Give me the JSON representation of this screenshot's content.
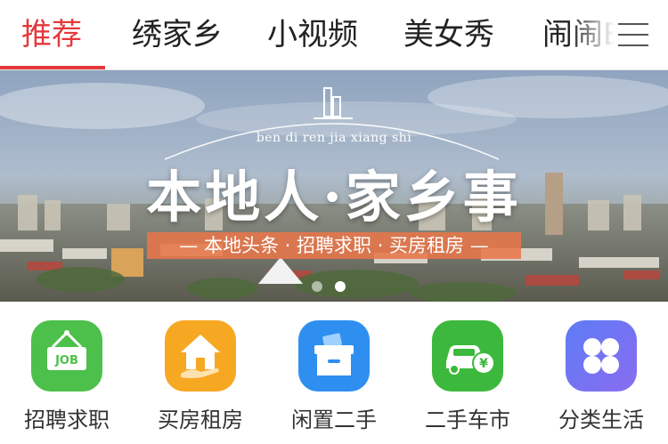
{
  "tabs": [
    {
      "label": "推荐",
      "active": true
    },
    {
      "label": "绣家乡",
      "active": false
    },
    {
      "label": "小视频",
      "active": false
    },
    {
      "label": "美女秀",
      "active": false
    },
    {
      "label": "闹闹E",
      "active": false
    }
  ],
  "menu_icon": "hamburger-menu-icon",
  "banner": {
    "subtitle": "ben di ren jia xiang shi",
    "title": "本地人·家乡事",
    "tagline": "— 本地头条 · 招聘求职 · 买房租房 —",
    "carousel_total": 2,
    "carousel_active": 2
  },
  "categories": [
    {
      "label": "招聘求职",
      "icon": "job-sign-icon",
      "color": "#4cc04a"
    },
    {
      "label": "买房租房",
      "icon": "house-hand-icon",
      "color": "#f7a823"
    },
    {
      "label": "闲置二手",
      "icon": "storage-box-icon",
      "color": "#2e8ff0"
    },
    {
      "label": "二手车市",
      "icon": "car-yen-icon",
      "color": "#3cb93c"
    },
    {
      "label": "分类生活",
      "icon": "clover-grid-icon",
      "color": "#6b72f0"
    }
  ],
  "colors": {
    "accent": "#e4393c",
    "tagline_bg": "#e8764a"
  }
}
